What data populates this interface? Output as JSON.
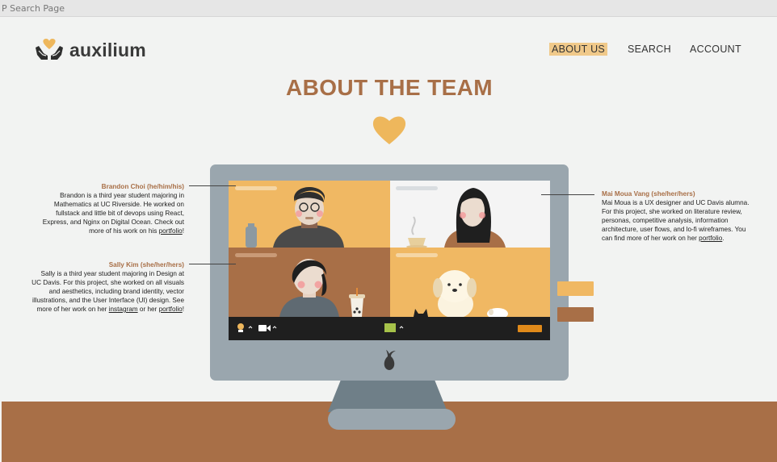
{
  "browser": {
    "tab_title": "P Search Page"
  },
  "brand": {
    "name": "auxilium"
  },
  "nav": {
    "about": "ABOUT US",
    "search": "SEARCH",
    "account": "ACCOUNT"
  },
  "page": {
    "title": "ABOUT THE TEAM"
  },
  "team": {
    "brandon": {
      "name": "Brandon Choi (he/him/his)",
      "bio": "Brandon is a third year student majoring in Mathematics at UC Riverside. He worked on fullstack and little bit of devops using React, Express, and Nginx on Digital Ocean. Check out more of his work on his ",
      "link": "portfolio",
      "end": "!"
    },
    "sally": {
      "name": "Sally Kim (she/her/hers)",
      "bio": "Sally is a third year student majoring in Design at UC Davis. For this project, she worked on all visuals and aesthetics, including brand identity, vector illustrations, and the User Interface (UI) design. See more of her work on her ",
      "link1": "instagram",
      "mid": " or her ",
      "link2": "portfolio",
      "end": "!"
    },
    "mai": {
      "name": "Mai Moua Vang (she/her/hers)",
      "bio": "Mai Moua is a UX designer and UC Davis alumna. For this project, she worked on literature review, personas, competitive analysis, information architecture, user flows, and lo-fi wireframes. You can find more of her work on her ",
      "link": "portfolio",
      "end": "."
    }
  },
  "colors": {
    "accent": "#a86f47",
    "gold": "#eeb75c",
    "monitor": "#9aa6ae",
    "background": "#f2f3f2"
  }
}
